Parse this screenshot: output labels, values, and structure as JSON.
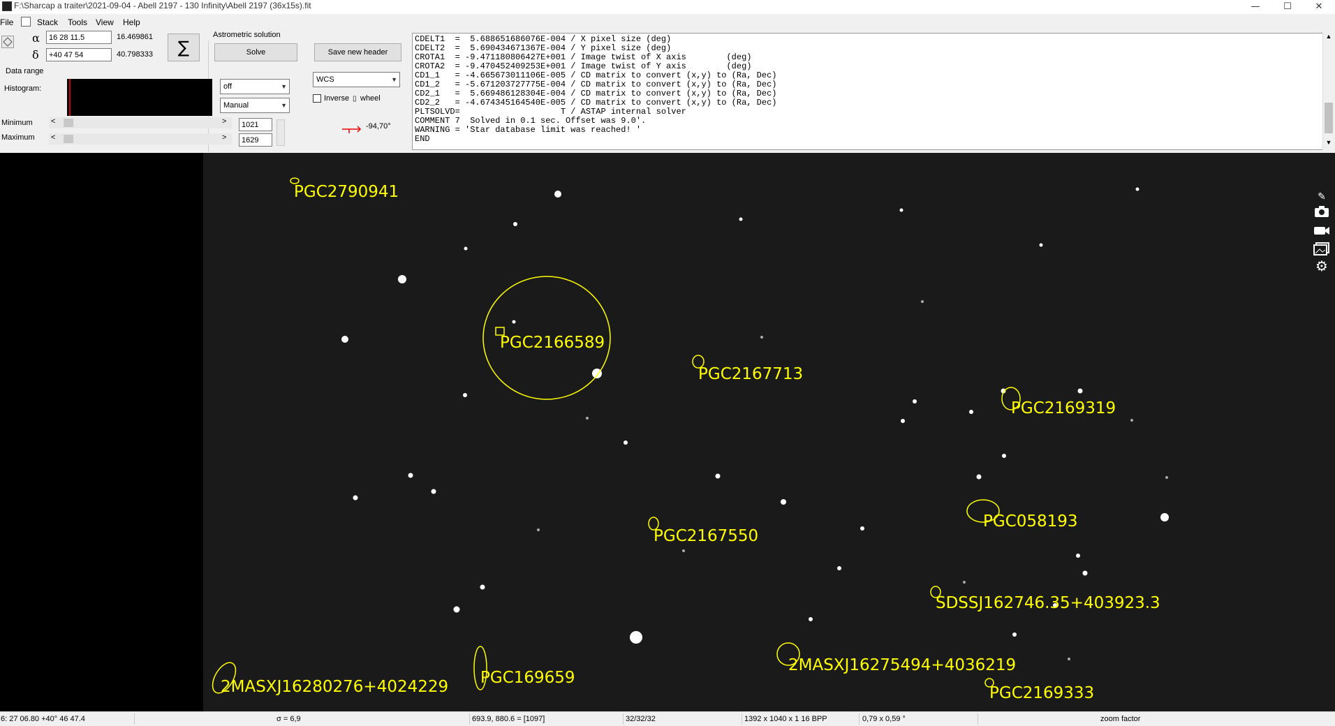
{
  "window": {
    "title": "F:\\Sharcap a traiter\\2021-09-04 - Abell 2197 - 130 Infinity\\Abell 2197 (36x15s).fit",
    "controls": {
      "minimize": "—",
      "maximize": "☐",
      "close": "✕"
    }
  },
  "menu": [
    "File",
    "Stack",
    "Tools",
    "View",
    "Help"
  ],
  "coords": {
    "alpha_symbol": "α",
    "delta_symbol": "δ",
    "alpha_value": "16 28 11.5",
    "delta_value": "+40 47 54",
    "alpha_decimal": "16.469861",
    "delta_decimal": "40.798333"
  },
  "sigma_button": "∑",
  "astrometric": {
    "label": "Astrometric solution",
    "solve": "Solve",
    "save": "Save new header"
  },
  "data_range": {
    "label": "Data range",
    "histogram_label": "Histogram:",
    "combo1": "off",
    "combo2": "Manual",
    "min_label": "Minimum",
    "max_label": "Maximum",
    "min_value": "1021",
    "max_value": "1629",
    "slider_left": "<",
    "slider_right": ">"
  },
  "wcs": {
    "combo": "WCS",
    "inverse_label": "Inverse",
    "wheel_label": "wheel",
    "angle": "-94,70°"
  },
  "header_lines": [
    "CDELT1  =  5.688651686076E-004 / X pixel size (deg)",
    "CDELT2  =  5.690434671367E-004 / Y pixel size (deg)",
    "CROTA1  = -9.471180806427E+001 / Image twist of X axis        (deg)",
    "CROTA2  = -9.470452409253E+001 / Image twist of Y axis        (deg)",
    "CD1_1   = -4.665673011106E-005 / CD matrix to convert (x,y) to (Ra, Dec)",
    "CD1_2   = -5.671203727775E-004 / CD matrix to convert (x,y) to (Ra, Dec)",
    "CD2_1   =  5.669486128304E-004 / CD matrix to convert (x,y) to (Ra, Dec)",
    "CD2_2   = -4.674345164540E-005 / CD matrix to convert (x,y) to (Ra, Dec)",
    "PLTSOLVD=                    T / ASTAP internal solver",
    "COMMENT 7  Solved in 0.1 sec. Offset was 9.0'.",
    "WARNING = 'Star database limit was reached! '",
    "END"
  ],
  "annotations": [
    "PGC2790941",
    "PGC2166589",
    "PGC2167713",
    "PGC2169319",
    "PGC058193",
    "PGC2167550",
    "SDSSJ162746.35+403923.3",
    "2MASXJ16275494+4036219",
    "PGC169659",
    "2MASXJ16280276+4024229",
    "PGC2169333"
  ],
  "annotation_color": "#ffff00",
  "side_icons": [
    "pin-icon",
    "camera-icon",
    "video-icon",
    "gallery-icon",
    "settings-icon"
  ],
  "status": {
    "coords": "6: 27  06.80   +40° 46  47.4",
    "sigma": "σ = 6,9",
    "position": "693.9, 880.6 = [1097]",
    "bits": "32/32/32",
    "dims": "1392 x 1040 x 1   16 BPP",
    "fov": "0,79 x 0,59 °",
    "zoom": "zoom factor"
  }
}
